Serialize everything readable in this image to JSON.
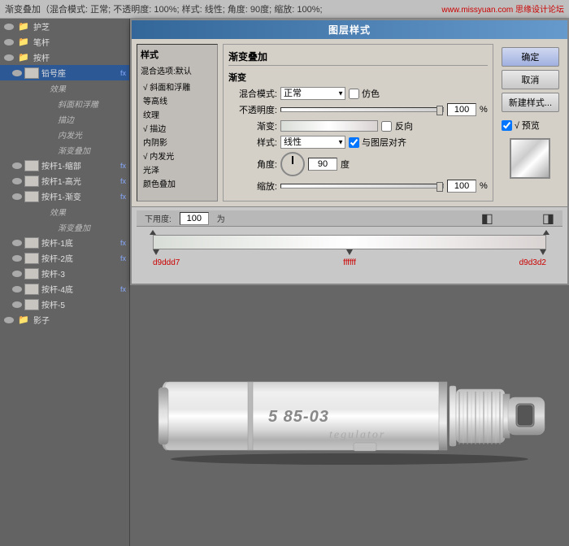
{
  "topbar": {
    "text": "渐变叠加（混合模式: 正常; 不透明度: 100%; 样式: 线性; 角度: 90度; 缩放: 100%;",
    "watermark": "www.missyuan.com 思缘设计论坛"
  },
  "dialog": {
    "title": "图层样式",
    "styles_title": "样式",
    "blending_title": "混合选项:默认",
    "styles_list": [
      {
        "label": "√ 斜面和浮雕",
        "checked": true,
        "active": false
      },
      {
        "label": "等高线",
        "checked": false,
        "active": false
      },
      {
        "label": "纹理",
        "checked": false,
        "active": false
      },
      {
        "label": "√ 描边",
        "checked": true,
        "active": false
      },
      {
        "label": "内阴影",
        "checked": false,
        "active": false
      },
      {
        "label": "√ 内发光",
        "checked": true,
        "active": false
      },
      {
        "label": "光泽",
        "checked": false,
        "active": false
      },
      {
        "label": "颜色叠加",
        "checked": false,
        "active": false
      }
    ],
    "section_title": "渐变叠加",
    "section_sub": "渐变",
    "blend_mode_label": "混合模式:",
    "blend_mode_value": "正常",
    "fake_color_label": "仿色",
    "opacity_label": "不透明度:",
    "opacity_value": "100",
    "gradient_label": "渐变:",
    "reverse_label": "反向",
    "style_label": "样式:",
    "style_value": "线性",
    "align_layer_label": "与图层对齐",
    "angle_label": "角度:",
    "angle_value": "90",
    "degree_symbol": "度",
    "scale_label": "缩放:",
    "scale_value": "100",
    "buttons": {
      "ok": "确定",
      "cancel": "取消",
      "new_style": "新建样式...",
      "preview": "√ 预览"
    },
    "color_stops": {
      "left": "d9ddd7",
      "center": "ffffff",
      "right": "d9d3d2"
    }
  },
  "layers": {
    "items": [
      {
        "id": "layer-huzhi",
        "name": "护芝",
        "type": "folder",
        "visible": true,
        "indent": 0
      },
      {
        "id": "layer-ganzhi",
        "name": "笔杆",
        "type": "folder",
        "visible": true,
        "indent": 0
      },
      {
        "id": "layer-anzhi",
        "name": "按杆",
        "type": "folder",
        "visible": true,
        "indent": 0,
        "expanded": true
      },
      {
        "id": "layer-biaohao",
        "name": "铅号座",
        "type": "layer",
        "visible": true,
        "indent": 1,
        "has_fx": true,
        "active": true
      },
      {
        "id": "layer-effects",
        "name": "效果",
        "type": "effects",
        "visible": false,
        "indent": 2
      },
      {
        "id": "layer-bevel",
        "name": "斜面和浮雕",
        "type": "effect",
        "visible": false,
        "indent": 3
      },
      {
        "id": "layer-stroke",
        "name": "描边",
        "type": "effect",
        "visible": false,
        "indent": 3
      },
      {
        "id": "layer-innerglow",
        "name": "内发光",
        "type": "effect",
        "visible": false,
        "indent": 3
      },
      {
        "id": "layer-gradient",
        "name": "渐变叠加",
        "type": "effect",
        "visible": false,
        "indent": 3
      },
      {
        "id": "layer-ankan1",
        "name": "按杆1-缩部",
        "type": "layer",
        "visible": true,
        "indent": 1,
        "has_fx": true
      },
      {
        "id": "layer-ankan1b",
        "name": "按杆1-高光",
        "type": "layer",
        "visible": true,
        "indent": 1,
        "has_fx": true
      },
      {
        "id": "layer-ankan1c",
        "name": "按杆1-渐变",
        "type": "layer",
        "visible": true,
        "indent": 1,
        "has_fx": true,
        "expanded": true
      },
      {
        "id": "layer-effects2",
        "name": "效果",
        "type": "effects",
        "visible": false,
        "indent": 2
      },
      {
        "id": "layer-gradient2",
        "name": "渐变叠加",
        "type": "effect",
        "visible": false,
        "indent": 3
      },
      {
        "id": "layer-ankan1d",
        "name": "按杆-1底",
        "type": "layer",
        "visible": true,
        "indent": 1,
        "has_fx": true
      },
      {
        "id": "layer-ankan2",
        "name": "按杆-2底",
        "type": "layer",
        "visible": true,
        "indent": 1,
        "has_fx": true
      },
      {
        "id": "layer-ankan3",
        "name": "按杆-3",
        "type": "layer",
        "visible": true,
        "indent": 1
      },
      {
        "id": "layer-ankan4",
        "name": "按杆-4底",
        "type": "layer",
        "visible": true,
        "indent": 1,
        "has_fx": true
      },
      {
        "id": "layer-ankan5",
        "name": "按杆-5",
        "type": "layer",
        "visible": true,
        "indent": 1
      },
      {
        "id": "layer-shadow",
        "name": "影子",
        "type": "folder",
        "visible": true,
        "indent": 0
      }
    ]
  },
  "canvas": {
    "device_text1": "5 85-03",
    "device_text2": "tegulator",
    "ruler": {
      "values": [
        "下用度:",
        "100",
        "为",
        ""
      ]
    }
  }
}
